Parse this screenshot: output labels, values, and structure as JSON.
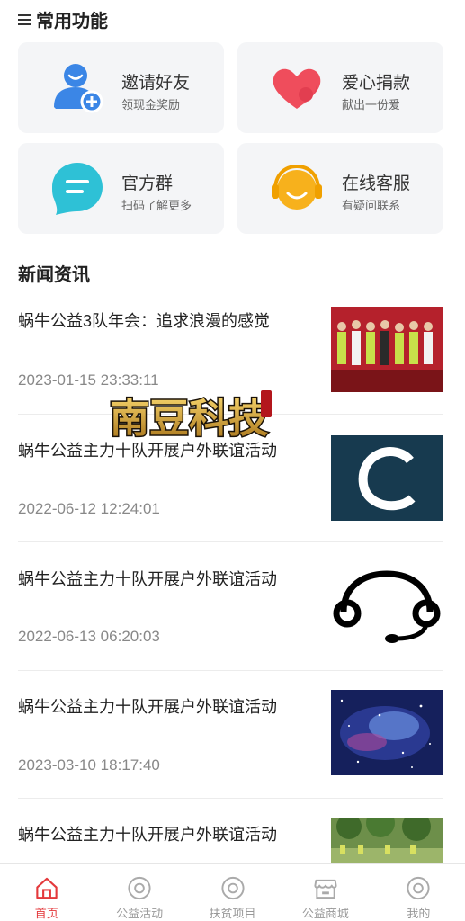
{
  "common": {
    "title": "常用功能",
    "items": [
      {
        "label": "邀请好友",
        "sub": "领现金奖励",
        "icon": "invite-user-icon"
      },
      {
        "label": "爱心捐款",
        "sub": "献出一份爱",
        "icon": "heart-donation-icon"
      },
      {
        "label": "官方群",
        "sub": "扫码了解更多",
        "icon": "chat-group-icon"
      },
      {
        "label": "在线客服",
        "sub": "有疑问联系",
        "icon": "headset-service-icon"
      }
    ]
  },
  "news": {
    "title": "新闻资讯",
    "items": [
      {
        "title": "蜗牛公益3队年会：追求浪漫的感觉",
        "time": "2023-01-15 23:33:11"
      },
      {
        "title": "蜗牛公益主力十队开展户外联谊活动",
        "time": "2022-06-12 12:24:01"
      },
      {
        "title": "蜗牛公益主力十队开展户外联谊活动",
        "time": "2022-06-13 06:20:03"
      },
      {
        "title": "蜗牛公益主力十队开展户外联谊活动",
        "time": "2023-03-10 18:17:40"
      },
      {
        "title": "蜗牛公益主力十队开展户外联谊活动",
        "time": ""
      }
    ]
  },
  "watermark": {
    "text": "南豆科技"
  },
  "tabbar": {
    "items": [
      {
        "label": "首页",
        "active": true
      },
      {
        "label": "公益活动",
        "active": false
      },
      {
        "label": "扶贫项目",
        "active": false
      },
      {
        "label": "公益商城",
        "active": false
      },
      {
        "label": "我的",
        "active": false
      }
    ]
  },
  "colors": {
    "accent": "#e4393c",
    "card_bg": "#f4f5f7",
    "invite_blue": "#3b86e6",
    "heart_red": "#ef4d5c",
    "chat_cyan": "#2ec1d6",
    "headset_orange": "#f7b11c"
  }
}
